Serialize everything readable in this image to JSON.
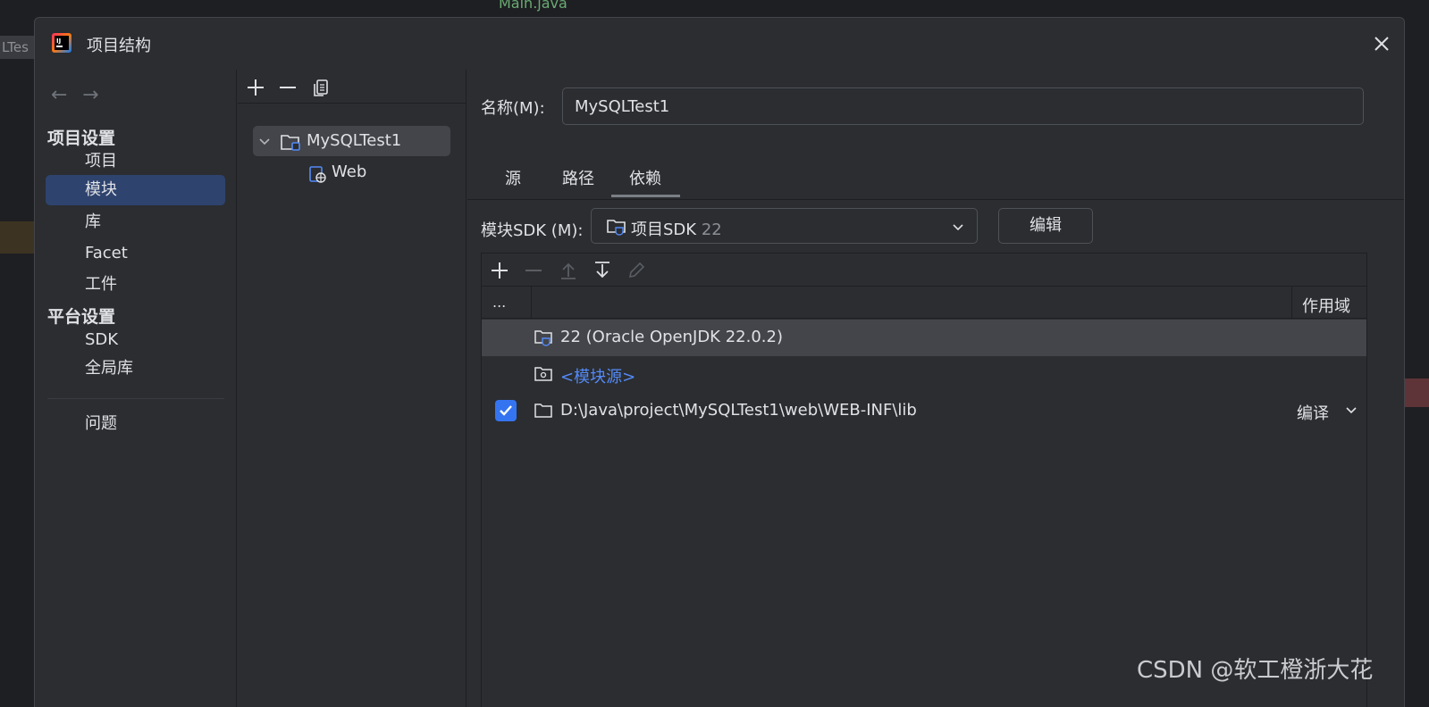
{
  "background": {
    "tab_label": "Main.java",
    "left_text": "LTes"
  },
  "dialog": {
    "title": "项目结构"
  },
  "nav": {
    "section_project": "项目设置",
    "items_project": [
      "项目",
      "模块",
      "库",
      "Facet",
      "工件"
    ],
    "section_platform": "平台设置",
    "items_platform": [
      "SDK",
      "全局库"
    ],
    "problems": "问题",
    "selected": "模块"
  },
  "tree": {
    "module": "MySQLTest1",
    "child": "Web"
  },
  "content": {
    "name_label": "名称(M):",
    "name_value": "MySQLTest1",
    "tabs": [
      "源",
      "路径",
      "依赖"
    ],
    "active_tab": "依赖",
    "sdk_label": "模块SDK (M):",
    "sdk_value": "项目SDK",
    "sdk_version": "22",
    "edit_button": "编辑",
    "table": {
      "col_dots": "...",
      "col_scope": "作用域",
      "rows": [
        {
          "text": "22 (Oracle OpenJDK 22.0.2)",
          "checked": false,
          "scope": ""
        },
        {
          "text": "<模块源>",
          "checked": false,
          "scope": ""
        },
        {
          "text": "D:\\Java\\project\\MySQLTest1\\web\\WEB-INF\\lib",
          "checked": true,
          "scope": "编译"
        }
      ]
    }
  },
  "watermark": "CSDN @软工橙浙大花",
  "colors": {
    "accent": "#3574f0",
    "link": "#548af7",
    "selected_nav": "#2e436e"
  }
}
